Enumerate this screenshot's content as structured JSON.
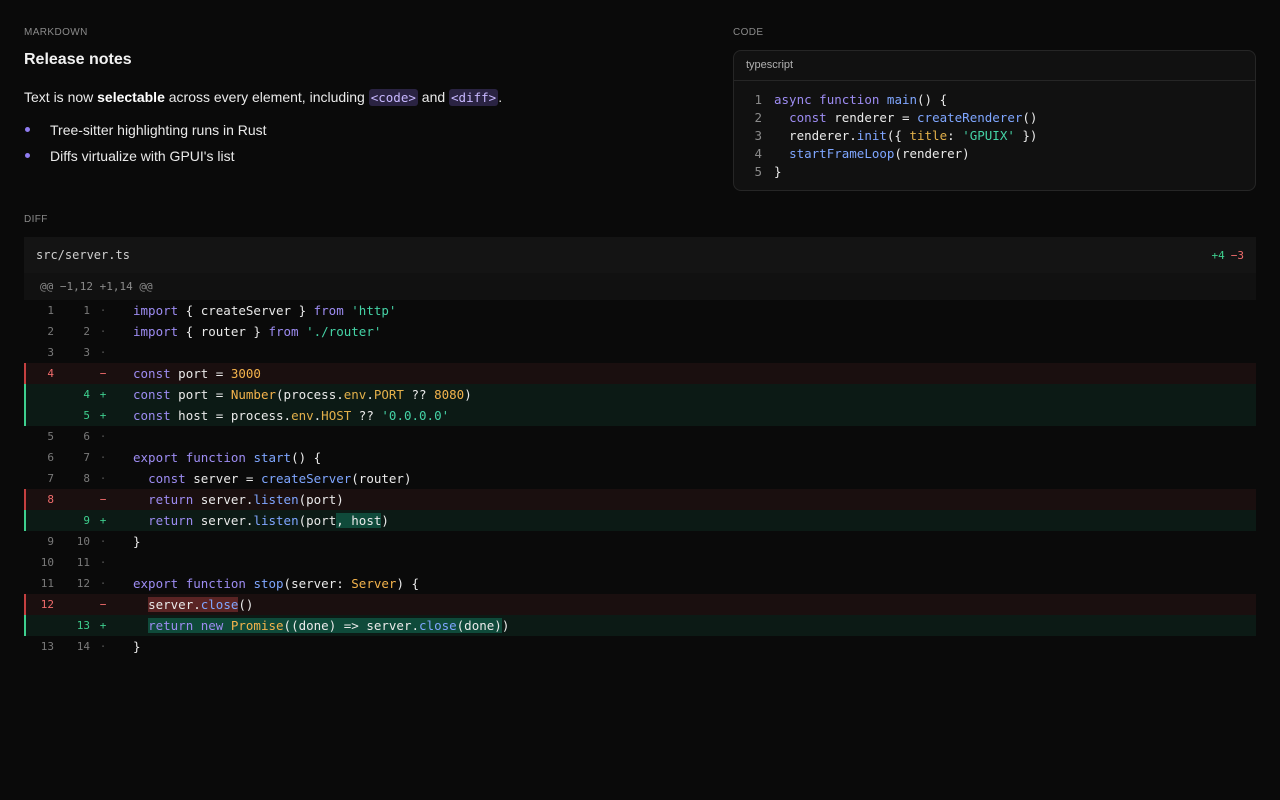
{
  "markdown": {
    "section_label": "MARKDOWN",
    "title": "Release notes",
    "para_prefix": "Text is now ",
    "para_bold": "selectable",
    "para_middle": " across every element, including ",
    "para_code1": "<code>",
    "para_and": " and ",
    "para_code2": "<diff>",
    "para_end": ".",
    "list": [
      "Tree-sitter highlighting runs in Rust",
      "Diffs virtualize with GPUI's list"
    ]
  },
  "code": {
    "section_label": "CODE",
    "language": "typescript",
    "line_numbers": [
      "1",
      "2",
      "3",
      "4",
      "5"
    ]
  },
  "diff": {
    "section_label": "DIFF",
    "file": "src/server.ts",
    "additions": "+4",
    "deletions": "−3",
    "hunk": "@@ −1,12 +1,14 @@",
    "rows": [
      {
        "type": "ctx",
        "old": "1",
        "new": "1",
        "mark": "·"
      },
      {
        "type": "ctx",
        "old": "2",
        "new": "2",
        "mark": "·"
      },
      {
        "type": "ctx",
        "old": "3",
        "new": "3",
        "mark": "·"
      },
      {
        "type": "del",
        "old": "4",
        "new": "",
        "mark": "−"
      },
      {
        "type": "add",
        "old": "",
        "new": "4",
        "mark": "+"
      },
      {
        "type": "add",
        "old": "",
        "new": "5",
        "mark": "+"
      },
      {
        "type": "ctx",
        "old": "5",
        "new": "6",
        "mark": "·"
      },
      {
        "type": "ctx",
        "old": "6",
        "new": "7",
        "mark": "·"
      },
      {
        "type": "ctx",
        "old": "7",
        "new": "8",
        "mark": "·"
      },
      {
        "type": "del",
        "old": "8",
        "new": "",
        "mark": "−"
      },
      {
        "type": "add",
        "old": "",
        "new": "9",
        "mark": "+"
      },
      {
        "type": "ctx",
        "old": "9",
        "new": "10",
        "mark": "·"
      },
      {
        "type": "ctx",
        "old": "10",
        "new": "11",
        "mark": "·"
      },
      {
        "type": "ctx",
        "old": "11",
        "new": "12",
        "mark": "·"
      },
      {
        "type": "del",
        "old": "12",
        "new": "",
        "mark": "−"
      },
      {
        "type": "add",
        "old": "",
        "new": "13",
        "mark": "+"
      },
      {
        "type": "ctx",
        "old": "13",
        "new": "14",
        "mark": "·"
      }
    ]
  }
}
